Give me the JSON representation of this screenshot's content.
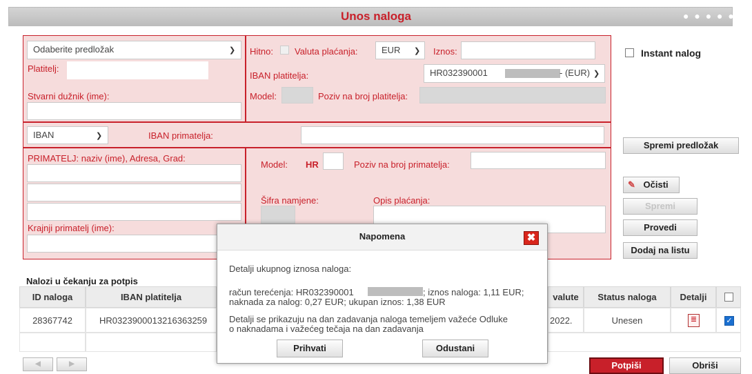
{
  "title": "Unos naloga",
  "form": {
    "template_select": "Odaberite predložak",
    "platitelj_label": "Platitelj:",
    "stvarni_duznik_label": "Stvarni dužnik (ime):",
    "hitno_label": "Hitno:",
    "valuta_label": "Valuta plaćanja:",
    "valuta_value": "EUR",
    "iznos_label": "Iznos:",
    "iban_platitelja_label": "IBAN platitelja:",
    "iban_platitelja_prefix": "HR032390001",
    "iban_platitelja_suffix": "- (EUR)",
    "model_label": "Model:",
    "poziv_platitelja_label": "Poziv na broj platitelja:",
    "account_type": "IBAN",
    "iban_primatelja_label": "IBAN primatelja:",
    "primatelj_label": "PRIMATELJ: naziv (ime), Adresa, Grad:",
    "krajnji_primatelj_label": "Krajnji primatelj (ime):",
    "model2_label": "Model:",
    "model2_value": "HR",
    "poziv_primatelja_label": "Poziv na broj primatelja:",
    "sifra_namjene_label": "Šifra namjene:",
    "opis_placanja_label": "Opis plaćanja:"
  },
  "side": {
    "instant_label": "Instant nalog",
    "spremi_predlozak": "Spremi predložak",
    "ocisti": "Očisti",
    "spremi": "Spremi",
    "provedi": "Provedi",
    "dodaj_na_listu": "Dodaj na listu"
  },
  "table": {
    "caption": "Nalozi u čekanju za potpis",
    "headers": [
      "ID naloga",
      "IBAN platitelja",
      "valute",
      "Status naloga",
      "Detalji"
    ],
    "rows": [
      {
        "id": "28367742",
        "iban": "HR0323900013216363259",
        "date": "2022.",
        "status": "Unesen",
        "checked": true
      }
    ]
  },
  "bottom": {
    "potpisi": "Potpiši",
    "obrisi": "Obriši"
  },
  "modal": {
    "title": "Napomena",
    "close_symbol": "✖",
    "line1": "Detalji ukupnog iznosa naloga:",
    "line2a": "račun terećenja: HR032390001",
    "line2b": "; iznos naloga: 1,11 EUR;",
    "line3": "naknada za nalog: 0,27 EUR; ukupan iznos: 1,38 EUR",
    "line4": "Detalji se prikazuju na dan zadavanja naloga temeljem važeće Odluke",
    "line5": "o naknadama i važećeg tečaja na dan zadavanja",
    "accept": "Prihvati",
    "cancel": "Odustani"
  },
  "colors": {
    "accent": "#c8202a",
    "panel": "#f6dcdc"
  }
}
